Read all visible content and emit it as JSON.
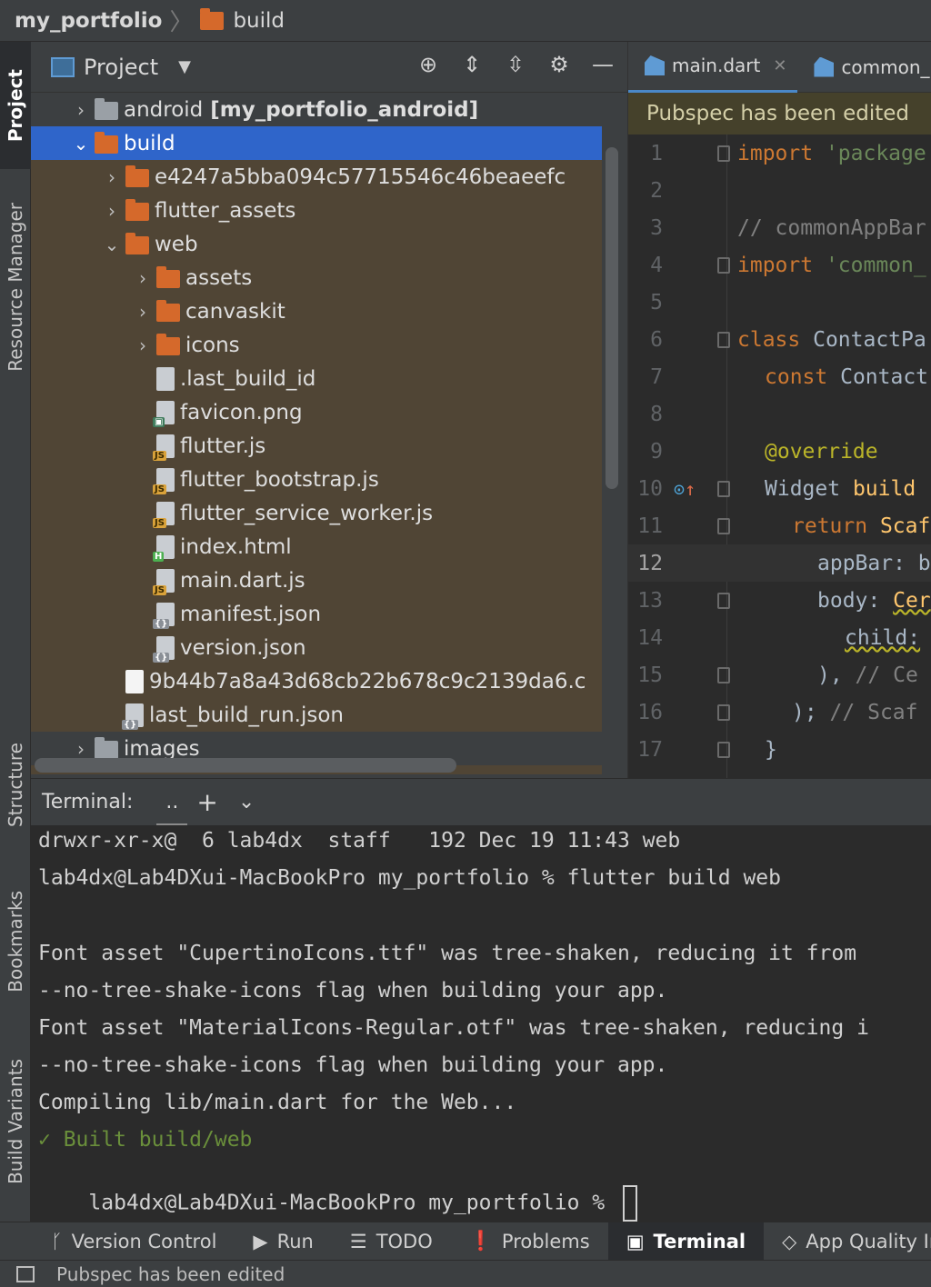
{
  "breadcrumb": {
    "root": "my_portfolio",
    "current": "build"
  },
  "left_stripe": {
    "project": "Project",
    "resource_manager": "Resource Manager",
    "structure": "Structure",
    "bookmarks": "Bookmarks",
    "build_variants": "Build Variants"
  },
  "project_panel": {
    "title": "Project",
    "tree": [
      {
        "label": "android",
        "suffix": "[my_portfolio_android]",
        "expanded": false,
        "icon": "module-folder-icon"
      },
      {
        "label": "build",
        "expanded": true,
        "selected": true,
        "icon": "build-folder-icon"
      },
      {
        "label": "e4247a5bba094c57715546c46beaeefc",
        "expanded": false,
        "icon": "folder-icon"
      },
      {
        "label": "flutter_assets",
        "expanded": false,
        "icon": "folder-icon"
      },
      {
        "label": "web",
        "expanded": true,
        "icon": "folder-icon"
      },
      {
        "label": "assets",
        "expanded": false,
        "icon": "folder-icon"
      },
      {
        "label": "canvaskit",
        "expanded": false,
        "icon": "folder-icon"
      },
      {
        "label": "icons",
        "expanded": false,
        "icon": "folder-icon"
      },
      {
        "label": ".last_build_id",
        "icon": "text-file-icon"
      },
      {
        "label": "favicon.png",
        "icon": "image-file-icon"
      },
      {
        "label": "flutter.js",
        "icon": "js-file-icon"
      },
      {
        "label": "flutter_bootstrap.js",
        "icon": "js-file-icon"
      },
      {
        "label": "flutter_service_worker.js",
        "icon": "js-file-icon"
      },
      {
        "label": "index.html",
        "icon": "html-file-icon"
      },
      {
        "label": "main.dart.js",
        "icon": "js-file-icon"
      },
      {
        "label": "manifest.json",
        "icon": "json-file-icon"
      },
      {
        "label": "version.json",
        "icon": "json-file-icon"
      },
      {
        "label": "9b44b7a8a43d68cb22b678c9c2139da6.c",
        "icon": "file-icon"
      },
      {
        "label": "last_build_run.json",
        "icon": "json-file-icon"
      },
      {
        "label": "images",
        "expanded": false,
        "icon": "folder-icon"
      }
    ]
  },
  "editor": {
    "tabs": [
      {
        "label": "main.dart"
      },
      {
        "label": "common_"
      }
    ],
    "banner": "Pubspec has been edited",
    "line_numbers": [
      "1",
      "2",
      "3",
      "4",
      "5",
      "6",
      "7",
      "8",
      "9",
      "10",
      "11",
      "12",
      "13",
      "14",
      "15",
      "16",
      "17"
    ],
    "current_line": 12,
    "code": {
      "l1_kw": "import",
      "l1_str": " 'package",
      "l3_cm": "// commonAppBar",
      "l4_kw": "import",
      "l4_str": " 'common_",
      "l6_kw": "class",
      "l6_rest": " ContactPa",
      "l7_kw": "const",
      "l7_rest": " Contact",
      "l9_ann": "@override",
      "l10_type": "Widget ",
      "l10_fn": "build",
      "l11_kw": "return",
      "l11_rest": " Scaf",
      "l12_rest": "appBar: b",
      "l13_rest": "body: ",
      "l13_fn": "Cer",
      "l14_rest": "child: ",
      "l15_rest": "),",
      "l15_cm": "  // Ce",
      "l16_rest": ");",
      "l16_cm": "  // Scaf",
      "l17_rest": "}"
    }
  },
  "terminal": {
    "label": "Terminal:",
    "tab": "..",
    "lines": [
      "drwxr-xr-x@  6 lab4dx  staff   192 Dec 19 11:43 web",
      "lab4dx@Lab4DXui-MacBookPro my_portfolio % flutter build web",
      "",
      "Font asset \"CupertinoIcons.ttf\" was tree-shaken, reducing it from",
      "--no-tree-shake-icons flag when building your app.",
      "Font asset \"MaterialIcons-Regular.otf\" was tree-shaken, reducing i",
      "--no-tree-shake-icons flag when building your app.",
      "Compiling lib/main.dart for the Web...",
      "✓ Built build/web",
      "lab4dx@Lab4DXui-MacBookPro my_portfolio % "
    ]
  },
  "bottom_tools": [
    {
      "label": "Version Control",
      "icon": "git-branch-icon"
    },
    {
      "label": "Run",
      "icon": "play-icon"
    },
    {
      "label": "TODO",
      "icon": "list-icon"
    },
    {
      "label": "Problems",
      "icon": "warning-icon"
    },
    {
      "label": "Terminal",
      "icon": "terminal-icon",
      "active": true
    },
    {
      "label": "App Quality Insi",
      "icon": "diamond-icon"
    }
  ],
  "status": {
    "message": "Pubspec has been edited"
  },
  "colors": {
    "selection": "#2f65ca",
    "tree_bg": "#504535",
    "folder": "#d5692b",
    "keyword": "#cc7832",
    "string": "#6a8759",
    "success": "#6a8f3b"
  }
}
